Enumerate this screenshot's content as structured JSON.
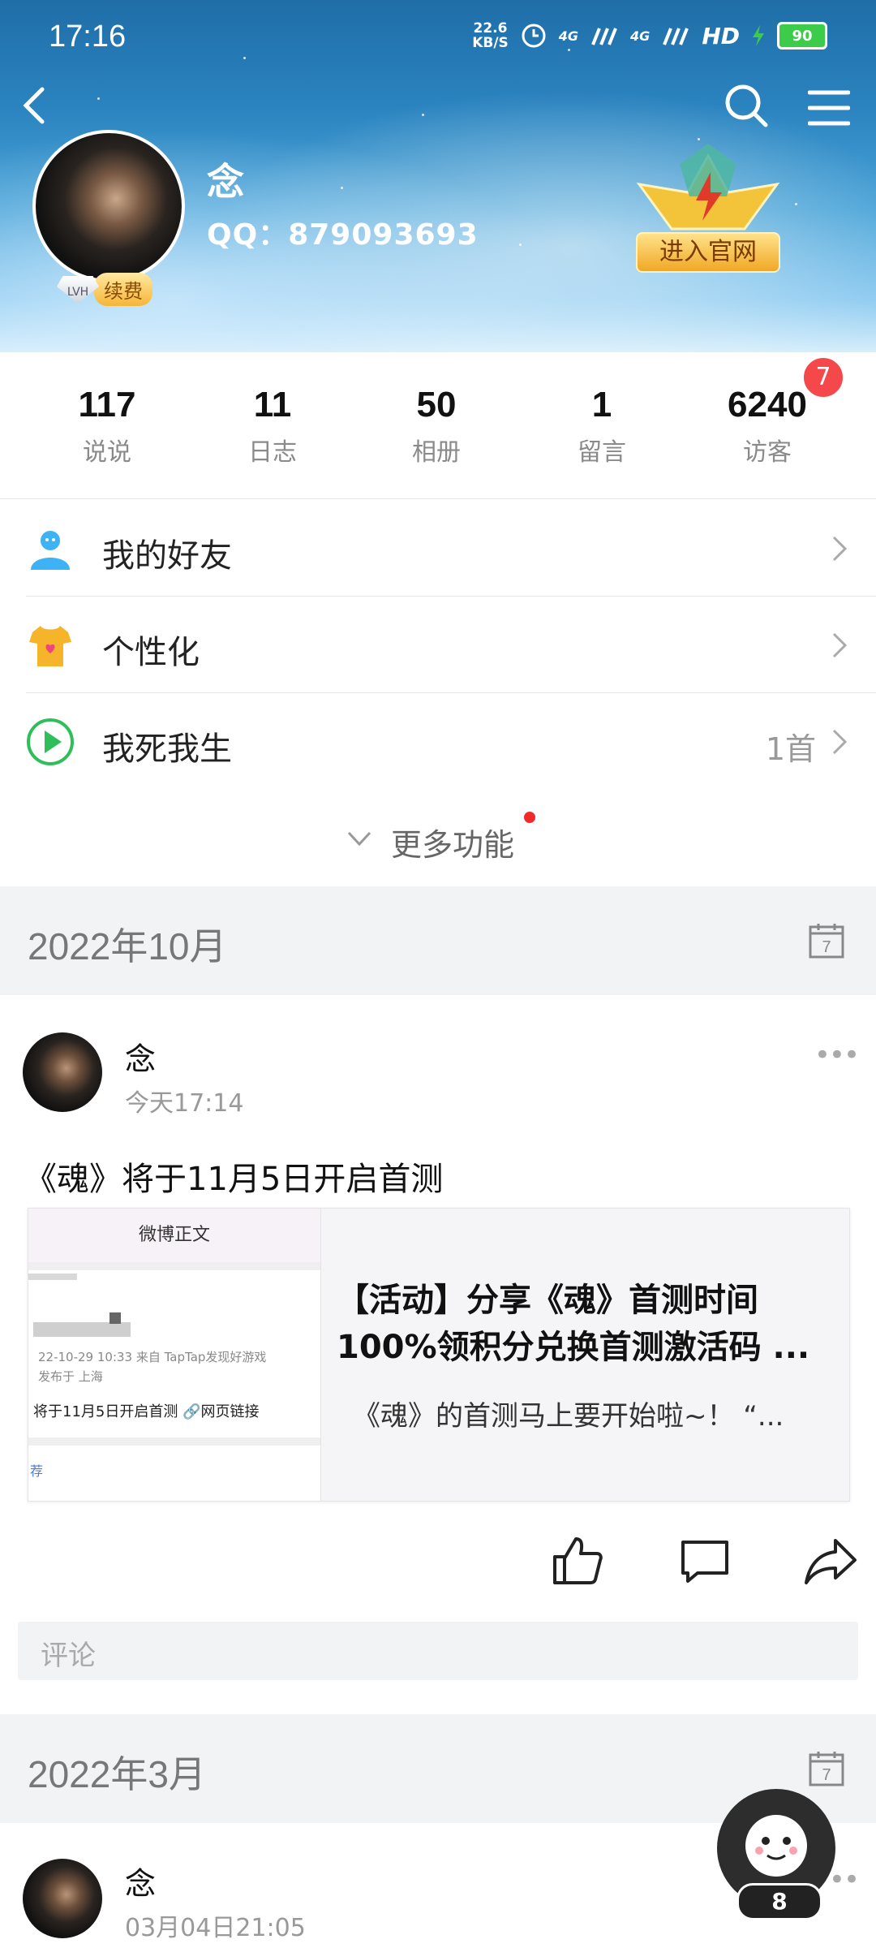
{
  "status_bar": {
    "time": "17:16",
    "net_speed_value": "22.6",
    "net_speed_unit": "KB/S",
    "signal1": "4G",
    "signal2": "4G",
    "hd": "HD",
    "battery": "90"
  },
  "profile": {
    "nickname": "念",
    "qq": "QQ：879093693",
    "vip_level": "LVH",
    "renew_label": "续费",
    "official_label": "进入官网"
  },
  "stats": [
    {
      "value": "117",
      "label": "说说"
    },
    {
      "value": "11",
      "label": "日志"
    },
    {
      "value": "50",
      "label": "相册"
    },
    {
      "value": "1",
      "label": "留言"
    },
    {
      "value": "6240",
      "label": "访客"
    }
  ],
  "visitor_badge": "7",
  "menu": {
    "friends": "我的好友",
    "personalize": "个性化",
    "music": "我死我生",
    "music_count": "1首",
    "more": "更多功能"
  },
  "feed": {
    "month1": "2022年10月",
    "month2": "2022年3月",
    "post1": {
      "name": "念",
      "time": "今天17:14",
      "text": "《魂》将于11月5日开启首测",
      "thumb_header": "微博正文",
      "thumb_meta1": "22-10-29 10:33  来自 TapTap发现好游戏",
      "thumb_meta2": "发布于 上海",
      "thumb_body": "将于11月5日开启首测 🔗网页链接",
      "thumb_footer": "荐",
      "card_title": "【活动】分享《魂》首测时间100%领积分兑换首测激活码 ...",
      "card_desc": "《魂》的首测马上要开始啦~！ “..."
    },
    "comment_placeholder": "评论",
    "post2": {
      "name": "念",
      "time": "03月04日21:05"
    }
  },
  "float_count": "8",
  "more_dots": "•••"
}
